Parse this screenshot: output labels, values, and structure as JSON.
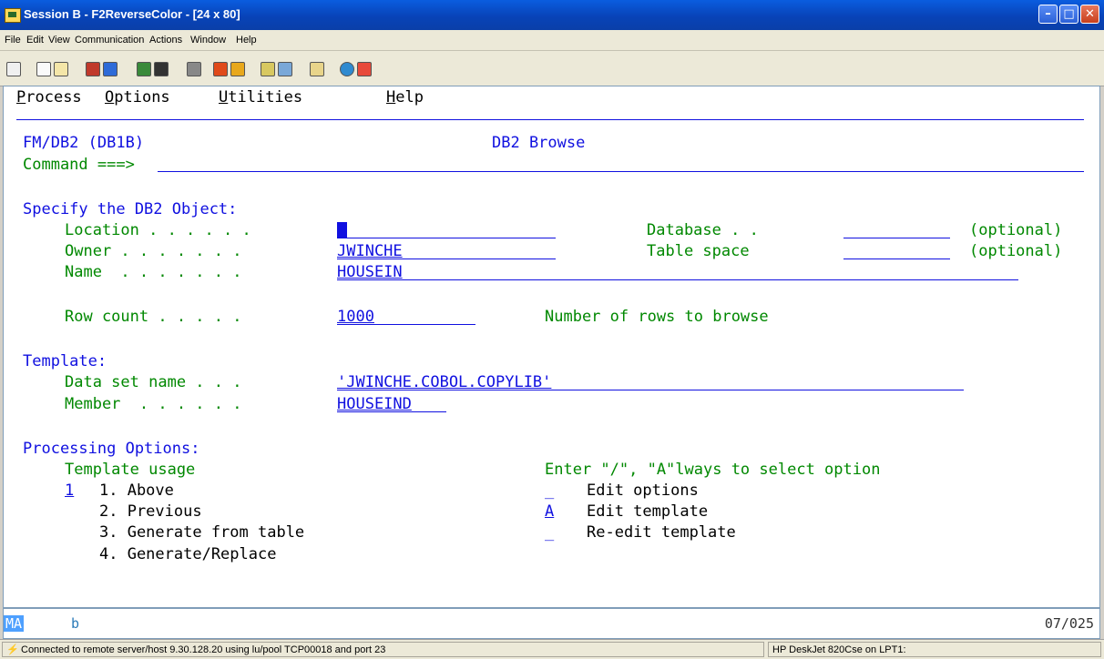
{
  "window": {
    "title": "Session B - F2ReverseColor - [24 x 80]",
    "minimize_glyph": "–",
    "maximize_glyph": "□",
    "close_glyph": "✕"
  },
  "menubar": {
    "items": [
      "File",
      "Edit",
      "View",
      "Communication",
      "Actions",
      "Window",
      "Help"
    ]
  },
  "toolbar": {
    "icons": [
      "display-icon",
      "copy-icon",
      "paste-icon",
      "send-icon",
      "receive-icon",
      "keyboard-map-icon",
      "screen-icon",
      "calculator-icon",
      "macro-record-icon",
      "macro-play-icon",
      "macro-stop-icon",
      "macro-run-icon",
      "clipboard-icon",
      "globe-icon",
      "bookmark-icon"
    ]
  },
  "terminal": {
    "action_bar": {
      "process": {
        "mnemonic": "P",
        "rest": "rocess"
      },
      "options": {
        "mnemonic": "O",
        "rest": "ptions"
      },
      "utilities": {
        "mnemonic": "U",
        "rest": "tilities"
      },
      "help": {
        "mnemonic": "H",
        "rest": "elp"
      }
    },
    "header_left": "FM/DB2 (DB1B)",
    "header_title": "DB2 Browse",
    "command_label": "Command ===>",
    "command_value": "",
    "spec_heading": "Specify the DB2 Object:",
    "location_label": "Location . . . . . .",
    "location_value": "",
    "database_label": "Database . .",
    "database_value": "",
    "database_hint": "(optional)",
    "owner_label": "Owner . . . . . . .",
    "owner_value": "JWINCHE",
    "tablespace_label": "Table space",
    "tablespace_value": "",
    "tablespace_hint": "(optional)",
    "name_label": "Name  . . . . . . .",
    "name_value": "HOUSEIN",
    "rowcount_label": "Row count . . . . .",
    "rowcount_value": "1000",
    "rowcount_hint": "Number of rows to browse",
    "template_heading": "Template:",
    "dsname_label": "Data set name . . .",
    "dsname_value": "'JWINCHE.COBOL.COPYLIB'",
    "member_label": "Member  . . . . . .",
    "member_value": "HOUSEIND",
    "proc_heading": "Processing Options:",
    "usage_heading": "Template usage",
    "usage_selected": "1",
    "usage_options": [
      "1. Above",
      "2. Previous",
      "3. Generate from table",
      "4. Generate/Replace"
    ],
    "option_hint": "Enter \"/\", \"A\"lways to select option",
    "edit_options_value": "_",
    "edit_options_label": "Edit options",
    "edit_template_value": "A",
    "edit_template_label": "Edit template",
    "reedit_value": "_",
    "reedit_label": "Re-edit template"
  },
  "oia": {
    "mode": "MA",
    "indicator": "b",
    "cursor_pos": "07/025"
  },
  "statusbar": {
    "connection": "Connected to remote server/host 9.30.128.20 using lu/pool TCP00018 and port 23",
    "printer": "HP DeskJet 820Cse on LPT1:"
  },
  "colors": {
    "field_text": "#1010e0",
    "label_text": "#008800",
    "title_bar": "#0843b8"
  }
}
